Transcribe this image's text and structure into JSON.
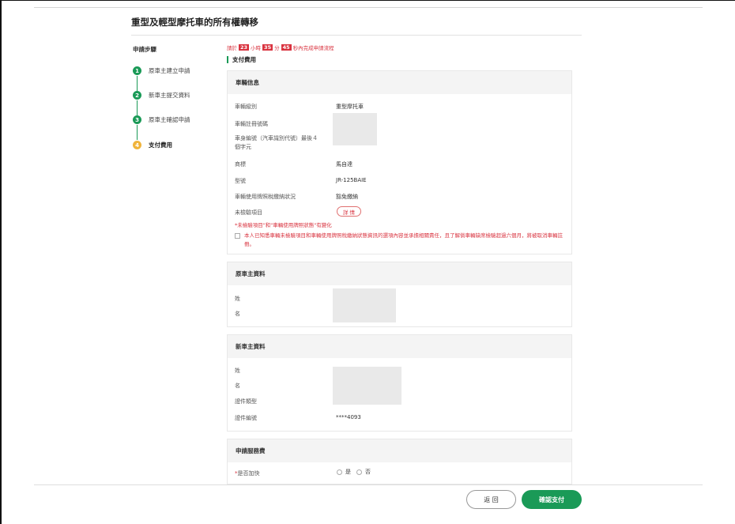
{
  "page_title": "重型及輕型摩托車的所有權轉移",
  "steps": {
    "title": "申請步驟",
    "items": [
      {
        "num": "1",
        "label": "原車主建立申請"
      },
      {
        "num": "2",
        "label": "新車主提交資料"
      },
      {
        "num": "3",
        "label": "原車主確認申請"
      },
      {
        "num": "4",
        "label": "支付費用"
      }
    ]
  },
  "countdown": {
    "prefix": "請於",
    "hours": "23",
    "hours_unit": "小時",
    "minutes": "35",
    "minutes_unit": "分",
    "seconds": "45",
    "suffix": "秒內完成申請流程"
  },
  "section_label": "支付費用",
  "vehicle_info": {
    "header": "車輛信息",
    "rows": [
      {
        "label": "車輛級別",
        "value": "重型摩托車"
      },
      {
        "label": "車輛註冊號碼",
        "value": ""
      },
      {
        "label": "車身編號（汽車識別代號）最後４",
        "label2": "個字元",
        "value": ""
      },
      {
        "label": "商標",
        "value": "馬自達"
      },
      {
        "label": "型號",
        "value": "JR-125BAIE"
      },
      {
        "label": "車輛使用牌照稅繳納狀況",
        "value": "豁免繳納"
      },
      {
        "label": "未檢驗項目",
        "value": ""
      }
    ],
    "detail_button": "詳 情",
    "red_note": "*未檢驗項目\"和\"車輛使用牌照狀態\"有變化",
    "consent_text": "本人已知悉車輛未檢驗項目和車輛使用牌照稅繳納狀態資訊的選項內容並承擔相關責任，且了解倘車輛缺席檢驗超過六個月，將被取消車輛註冊。"
  },
  "original_owner": {
    "header": "原車主資料",
    "rows": [
      {
        "label": "姓"
      },
      {
        "label": "名"
      }
    ]
  },
  "new_owner": {
    "header": "新車主資料",
    "rows": [
      {
        "label": "姓",
        "value": ""
      },
      {
        "label": "名",
        "value": ""
      },
      {
        "label": "證件類型",
        "value": ""
      },
      {
        "label": "證件編號",
        "value": "****4093"
      }
    ]
  },
  "service_fee": {
    "header": "申請服務費",
    "expedite_label": "是否加快",
    "required_mark": "*",
    "option_yes": "是",
    "option_no": "否"
  },
  "footer": {
    "back_label": "返 回",
    "confirm_label": "確認支付"
  },
  "colors": {
    "accent_green": "#1a9a57",
    "active_step": "#f0b43c",
    "warning_red": "#d9333f"
  }
}
